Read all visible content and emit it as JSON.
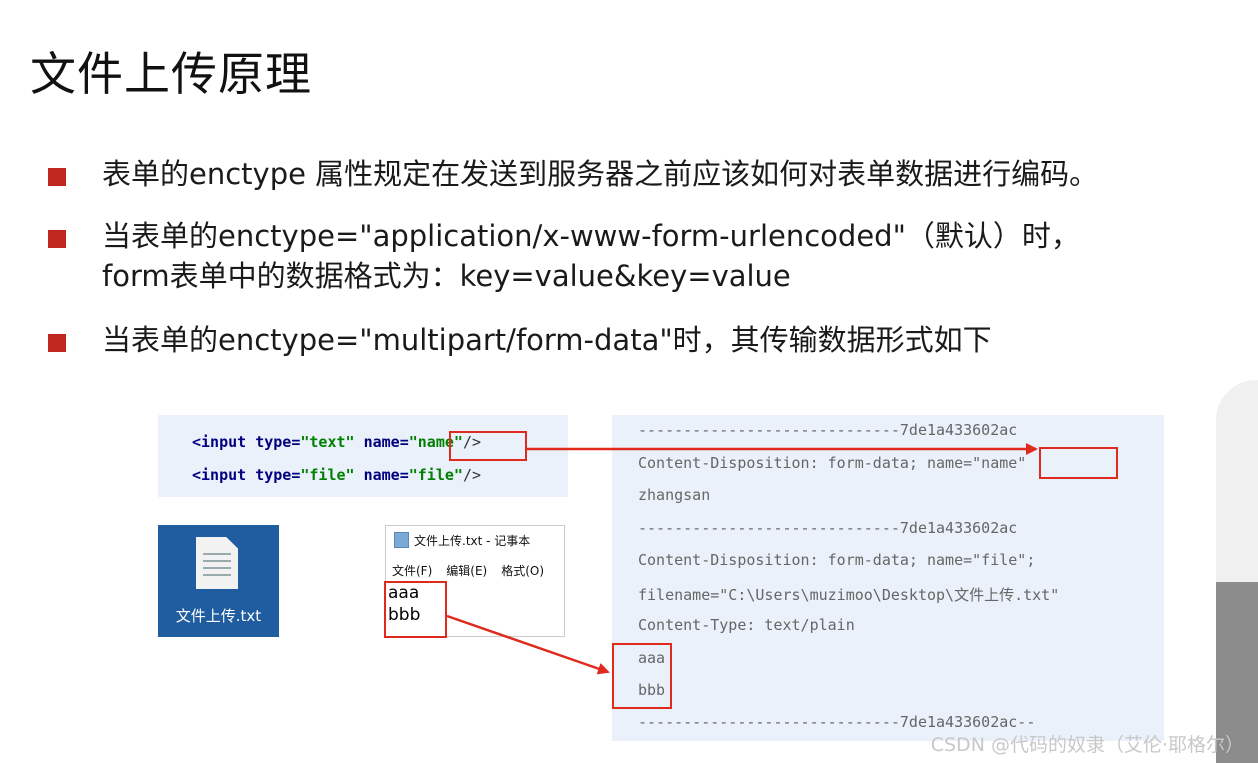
{
  "title": "文件上传原理",
  "bullets": {
    "b1": "表单的enctype 属性规定在发送到服务器之前应该如何对表单数据进行编码。",
    "b2_line1": "当表单的enctype=\"application/x-www-form-urlencoded\"（默认）时，",
    "b2_line2": "form表单中的数据格式为：key=value&key=value",
    "b3": "当表单的enctype=\"multipart/form-data\"时，其传输数据形式如下"
  },
  "html_code": {
    "row1": {
      "open": "<input ",
      "attr1": "type=",
      "val1": "\"text\"",
      "attr2": " name=",
      "val2": "\"name\"",
      "close": "/>"
    },
    "row2": {
      "open": "<input ",
      "attr1": "type=",
      "val1": "\"file\"",
      "attr2": " name=",
      "val2": "\"file\"",
      "close": "/>"
    }
  },
  "file_icon": {
    "label": "文件上传.txt",
    "icon": "text-file-icon"
  },
  "notepad": {
    "title": "文件上传.txt - 记事本",
    "menu": [
      "文件(F)",
      "编辑(E)",
      "格式(O)"
    ],
    "line1": "aaa",
    "line2": "bbb"
  },
  "request_body": {
    "boundary1": "-----------------------------7de1a433602ac",
    "disp1_prefix": "Content-Disposition: form-data; name=",
    "disp1_name": "\"name\"",
    "value1": "zhangsan",
    "boundary2": "-----------------------------7de1a433602ac",
    "disp2": "Content-Disposition:  form-data;  name=\"file\";",
    "filename": "filename=\"C:\\Users\\muzimoo\\Desktop\\文件上传.txt\"",
    "content_type": "Content-Type: text/plain",
    "file_line1": "aaa",
    "file_line2": "bbb",
    "boundary_end": "-----------------------------7de1a433602ac--"
  },
  "colors": {
    "accent_red": "#c0281f",
    "highlight_red": "#e02a1e",
    "code_bg": "#eaf1fa"
  },
  "watermark": "CSDN @代码的奴隶（艾伦·耶格尔）"
}
